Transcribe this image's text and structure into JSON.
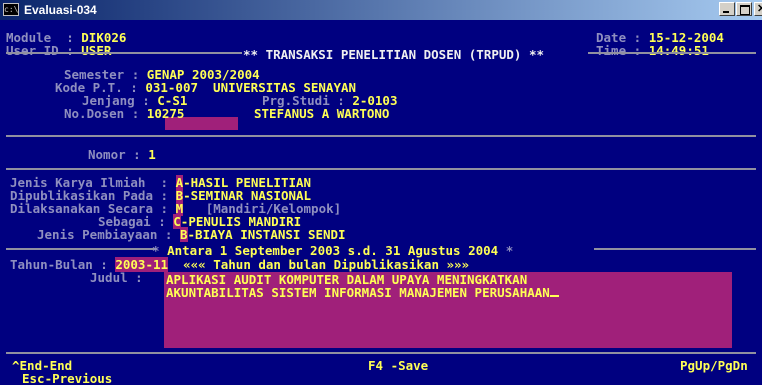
{
  "window": {
    "title": "Evaluasi-034",
    "icon": "console-icon",
    "buttons": [
      "minimize-icon",
      "maximize-icon",
      "close-icon"
    ]
  },
  "header": {
    "module_label": "Module  : ",
    "module_value": "DIK026",
    "user_label": "User ID : ",
    "user_value": "USER",
    "date_label": "Date : ",
    "date_value": "15-12-2004",
    "time_label": "Time : ",
    "time_value": "14:49:51",
    "screen_title": "** TRANSAKSI PENELITIAN DOSEN (TRPUD) **"
  },
  "info": {
    "semester_label": "Semester : ",
    "semester_value": "GENAP 2003/2004",
    "kode_pt_label": "Kode P.T. : ",
    "kode_pt_value": "031-007  UNIVERSITAS SENAYAN",
    "jenjang_label": "Jenjang : ",
    "jenjang_value": "C-S1",
    "prg_studi_label": "Prg.Studi : ",
    "prg_studi_value": "2-0103",
    "no_dosen_label": "No.Dosen : ",
    "no_dosen_value": "10275",
    "dosen_name": "STEFANUS A WARTONO"
  },
  "nomor": {
    "label": "Nomor : ",
    "value": "1"
  },
  "form": {
    "jenis_karya_label": "Jenis Karya Ilmiah  : ",
    "jenis_karya_code": "A",
    "jenis_karya_desc": "-HASIL PENELITIAN",
    "dipublikasikan_label": "Dipublikasikan Pada : ",
    "dipublikasikan_code": "B",
    "dipublikasikan_desc": "-SEMINAR NASIONAL",
    "dilaksanakan_label": "Dilaksanakan Secara : ",
    "dilaksanakan_code": "M",
    "dilaksanakan_hint": "[Mandiri/Kelompok]",
    "sebagai_label": "Sebagai : ",
    "sebagai_code": "C",
    "sebagai_desc": "-PENULIS MANDIRI",
    "pembiayaan_label": "Jenis Pembiayaan : ",
    "pembiayaan_code": "B",
    "pembiayaan_desc": "-BIAYA INSTANSI SENDI",
    "range_text": "Antara 1 September 2003 s.d. 31 Agustus 2004",
    "tahun_bulan_label": "Tahun-Bulan : ",
    "tahun_bulan_value": "2003-11",
    "tahun_bulan_hint": "««« Tahun dan bulan Dipublikasikan »»»",
    "judul_label": "Judul : ",
    "judul_line1": "APLIKASI AUDIT KOMPUTER DALAM UPAYA MENINGKATKAN",
    "judul_line2": "AKUNTABILITAS SISTEM INFORMASI MANAJEMEN PERUSAHAAN"
  },
  "footer": {
    "end_key": "^End-End",
    "esc_key": "Esc-Previous",
    "f4_key": "F4 -Save",
    "page_keys": "PgUp/PgDn"
  },
  "colors": {
    "console_bg": "#000080",
    "text": "#f0f0f0",
    "value": "#ffff55",
    "label_dim": "#8f8fbf",
    "field_bg": "#a0207a"
  }
}
